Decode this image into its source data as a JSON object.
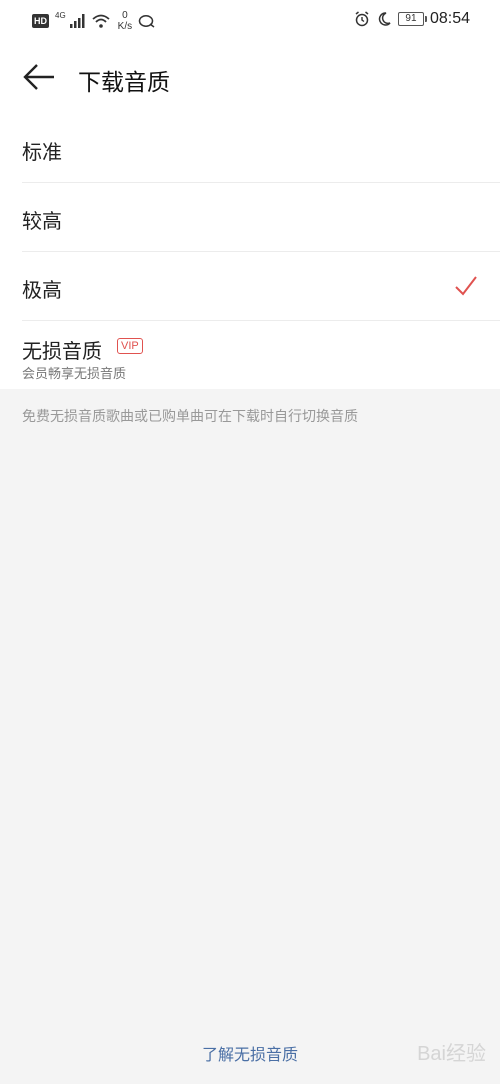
{
  "status_bar": {
    "hd": "HD",
    "network": "4G",
    "speed_value": "0",
    "speed_unit": "K/s",
    "battery": "91",
    "time": "08:54"
  },
  "header": {
    "title": "下载音质"
  },
  "quality_options": [
    {
      "label": "标准",
      "selected": false
    },
    {
      "label": "较高",
      "selected": false
    },
    {
      "label": "极高",
      "selected": true
    },
    {
      "label": "无损音质",
      "badge": "VIP",
      "sublabel": "会员畅享无损音质",
      "selected": false
    }
  ],
  "note": "免费无损音质歌曲或已购单曲可在下载时自行切换音质",
  "footer": {
    "link": "了解无损音质"
  },
  "watermark": "Bai经验",
  "colors": {
    "accent_check": "#e0524f",
    "link": "#4a6fa5",
    "background": "#f4f4f4"
  }
}
